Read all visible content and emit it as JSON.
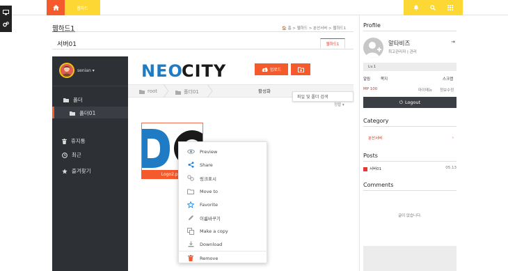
{
  "topbar": {
    "tab_label": "웹하드",
    "accent": "#f55a2c",
    "yellow": "#fdd835"
  },
  "page": {
    "title": "웹하드1",
    "breadcrumb": "🏠 홈 > 웹하드 > 분산서버 > 웹하드1",
    "sub_title": "서버01",
    "tab_label": "웹하드1"
  },
  "sidebar": {
    "user": "senian",
    "items": [
      {
        "label": "폴더",
        "icon": "folder-icon"
      },
      {
        "label": "폴더01",
        "icon": "folder-icon"
      },
      {
        "label": "휴지통",
        "icon": "trash-icon"
      },
      {
        "label": "최근",
        "icon": "clock-icon"
      },
      {
        "label": "즐겨찾기",
        "icon": "star-icon"
      }
    ]
  },
  "main": {
    "logo_text": "NEOCITY",
    "upload_label": "업로드",
    "crumbs": [
      "root",
      "폴더01"
    ],
    "active_label": "활성화",
    "search_tooltip": "파일 및 폴더 검색",
    "sort_label": "정렬 ▾",
    "file": {
      "name": "Logo2.png"
    }
  },
  "context_menu": [
    {
      "label": "Preview",
      "icon": "eye-icon"
    },
    {
      "label": "Share",
      "icon": "share-icon"
    },
    {
      "label": "링크표시",
      "icon": "link-icon"
    },
    {
      "label": "Move to",
      "icon": "folder-outline-icon"
    },
    {
      "label": "Favorite",
      "icon": "star-outline-icon"
    },
    {
      "label": "이름바꾸기",
      "icon": "pencil-icon"
    },
    {
      "label": "Make a copy",
      "icon": "copy-icon"
    },
    {
      "label": "Download",
      "icon": "download-icon"
    },
    {
      "label": "Remove",
      "icon": "trash-icon"
    }
  ],
  "right": {
    "profile_head": "Profile",
    "name": "알타비즈",
    "role": "최고관리자 | 관리",
    "level": "Lv.1",
    "alarm": "알림",
    "note": "쪽지",
    "scrap": "스크랩",
    "mp": "MP 100",
    "mypage": "마이메뉴",
    "edit": "정보수정",
    "logout": "Logout",
    "category_head": "Category",
    "category_item": "분산서버",
    "posts_head": "Posts",
    "post_title": "서버01",
    "post_date": "05.13",
    "comments_head": "Comments",
    "empty": "글이 없습니다."
  }
}
